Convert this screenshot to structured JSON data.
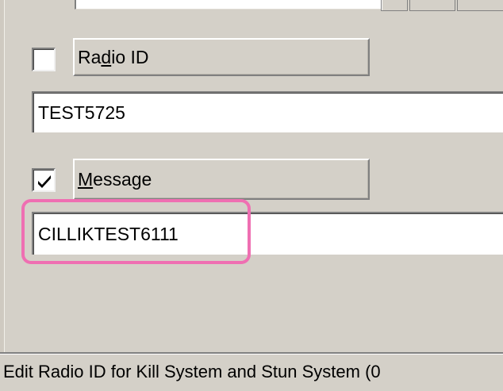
{
  "radio_id": {
    "checked": false,
    "label_pre": "Ra",
    "label_mnemonic": "d",
    "label_post": "io ID",
    "value": "TEST5725"
  },
  "message": {
    "checked": true,
    "label_pre": "",
    "label_mnemonic": "M",
    "label_post": "essage",
    "value": "CILLIKTEST6111"
  },
  "highlight_color": "#ef6fb2",
  "status_text": "Edit Radio ID for Kill System and Stun System (0"
}
